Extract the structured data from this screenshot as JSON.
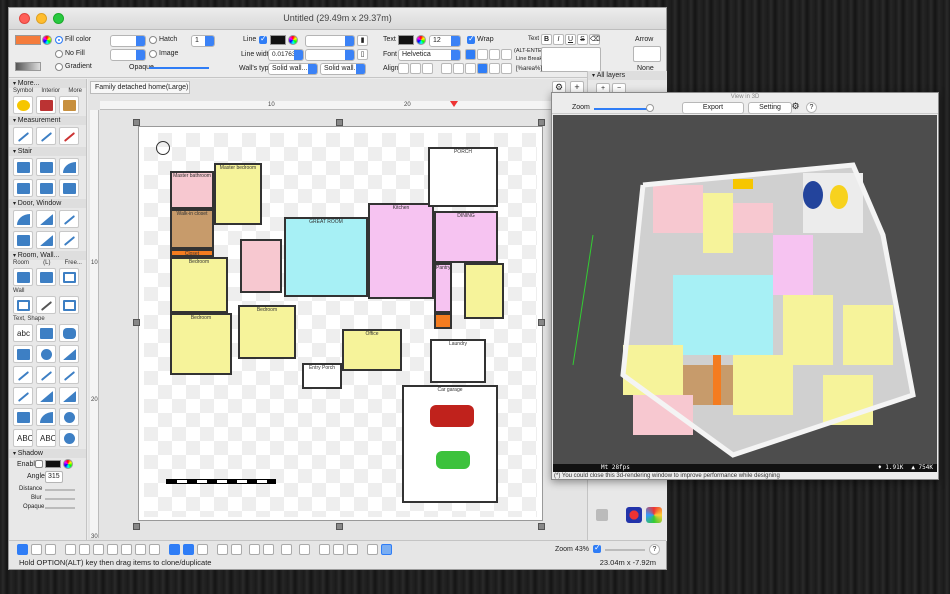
{
  "window": {
    "title": "Untitled (29.49m x 29.37m)"
  },
  "toolbar": {
    "fill_color": "Fill color",
    "no_fill": "No Fill",
    "gradient": "Gradient",
    "hatch": "Hatch",
    "hatch_value": "1",
    "image": "Image",
    "opaque": "Opaque",
    "line": "Line",
    "line_width_label": "Line width",
    "line_width_value": "0.017639 (1px)",
    "walls_type_label": "Wall's type",
    "walls_type_1": "Solid wall...",
    "walls_type_2": "Solid wall...",
    "text": "Text",
    "font_size": "12",
    "wrap": "Wrap",
    "font_label": "Font",
    "font_value": "Helvetica",
    "align_label": "Align",
    "text2": "Text",
    "bold": "B",
    "italic": "I",
    "underline": "U",
    "strike": "S",
    "alt_enter": "(ALT-ENTER:",
    "line_break": "Line Break)",
    "area_token": "[%area%]",
    "arrow": "Arrow",
    "arrow_value": "None"
  },
  "sidebar": {
    "more_header": "More...",
    "more_sublabels": [
      "Symbol",
      "Interior",
      "More"
    ],
    "measurement": "Measurement",
    "stair": "Stair",
    "door_window": "Door, Window",
    "room_wall": "Room, Wall...",
    "room_sublabels": [
      "Room",
      "(L)",
      "Free..."
    ],
    "wall": "Wall",
    "text_shape": "Text, Shape",
    "text_tool_1": "abc",
    "text_tool_2": "ABC",
    "text_tool_3": "ABC",
    "shadow": "Shadow",
    "enable": "Enable",
    "angle_label": "Angle",
    "angle_value": "315",
    "distance": "Distance",
    "blur": "Blur",
    "opaque": "Opaque"
  },
  "document": {
    "tab": "Family detached home(Large)",
    "ruler_h": [
      "10",
      "20"
    ],
    "ruler_v": [
      "10",
      "20",
      "30"
    ],
    "gear_icon": "gear-icon",
    "add_icon": "plus-icon",
    "zoom_label": "Zoom",
    "zoom_value": "43%",
    "help": "?"
  },
  "plan_labels": {
    "master_bathroom": "Master bathroom",
    "master_bedroom": "Master bedroom",
    "walk_in_closet": "Walk-in closet",
    "closet": "Closet",
    "bedroom_1": "Bedroom",
    "bedroom_2": "Bedroom",
    "bedroom_3": "Bedroom",
    "great_room": "GREAT ROOM",
    "porch": "PORCH",
    "kitchen": "Kitchen",
    "dining": "DINING",
    "pantry": "Pantry",
    "office": "Office",
    "laundry": "Laundry",
    "entry_porch": "Entry Porch",
    "car_garage": "Car garage"
  },
  "layers": {
    "header": "All layers",
    "add": "+",
    "remove": "−"
  },
  "view3d": {
    "title": "View in 3D",
    "zoom_label": "Zoom",
    "export": "Export",
    "setting": "Setting",
    "help": "?",
    "status_fps": "Mt 28fps",
    "status_tris": "♦ 1.91K",
    "status_verts": "▲ 754K",
    "note": "(*) You could close this 3d-rendering window to improve performance while designing"
  },
  "statusbar": {
    "hint": "Hold OPTION(ALT) key then drag items to clone/duplicate",
    "coords": "23.04m x -7.92m"
  },
  "colors": {
    "fill": "#f47c3c",
    "bedroom": "#f6f39a",
    "great_room": "#a7f0f5",
    "kitchen": "#f6c3f1",
    "bath": "#f7c8d0",
    "closet": "#f47c20",
    "wood": "#c79b6b"
  }
}
